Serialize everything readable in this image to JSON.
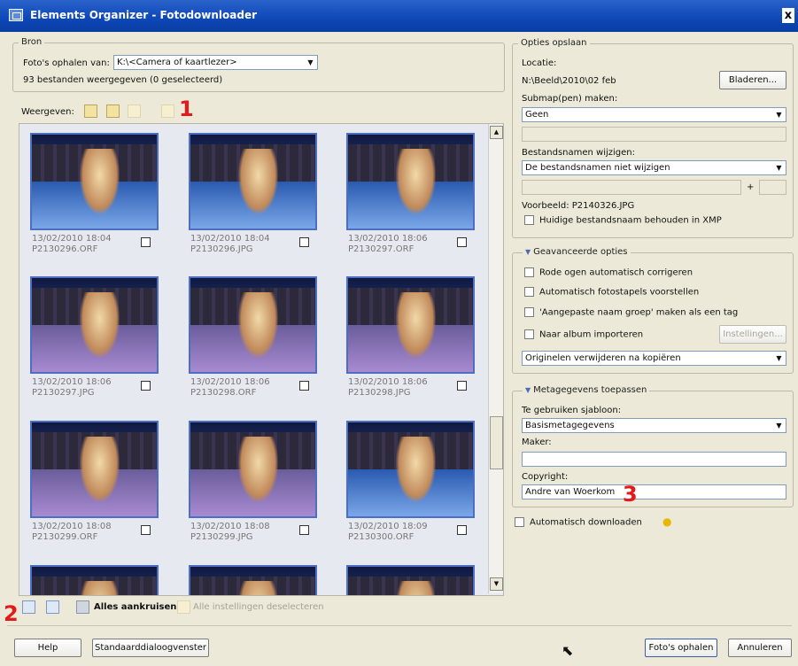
{
  "window": {
    "title": "Elements Organizer - Fotodownloader",
    "close_glyph": "x"
  },
  "source": {
    "legend": "Bron",
    "get_from_label": "Foto's ophalen van:",
    "get_from_value": "K:\\<Camera of kaartlezer>",
    "count_text": "93 bestanden weergegeven (0 geselecteerd)"
  },
  "view": {
    "label": "Weergeven:"
  },
  "thumbnails": [
    {
      "date": "13/02/2010 18:04",
      "file": "P2130296.ORF"
    },
    {
      "date": "13/02/2010 18:04",
      "file": "P2130296.JPG"
    },
    {
      "date": "13/02/2010 18:06",
      "file": "P2130297.ORF"
    },
    {
      "date": "13/02/2010 18:06",
      "file": "P2130297.JPG"
    },
    {
      "date": "13/02/2010 18:06",
      "file": "P2130298.ORF"
    },
    {
      "date": "13/02/2010 18:06",
      "file": "P2130298.JPG"
    },
    {
      "date": "13/02/2010 18:08",
      "file": "P2130299.ORF"
    },
    {
      "date": "13/02/2010 18:08",
      "file": "P2130299.JPG"
    },
    {
      "date": "13/02/2010 18:09",
      "file": "P2130300.ORF"
    },
    {
      "date": "",
      "file": ""
    },
    {
      "date": "",
      "file": ""
    },
    {
      "date": "",
      "file": ""
    }
  ],
  "bottom_toolbar": {
    "check_all": "Alles aankruisen",
    "uncheck_all": "Alle instellingen deselecteren"
  },
  "save_options": {
    "legend": "Opties opslaan",
    "location_label": "Locatie:",
    "location_value": "N:\\Beeld\\2010\\02 feb",
    "browse": "Bladeren...",
    "subfolder_label": "Submap(pen) maken:",
    "subfolder_value": "Geen",
    "rename_label": "Bestandsnamen wijzigen:",
    "rename_value": "De bestandsnamen niet wijzigen",
    "plus": "+",
    "preview": "Voorbeeld: P2140326.JPG",
    "keep_name": "Huidige bestandsnaam behouden in XMP"
  },
  "advanced": {
    "header": "Geavanceerde opties",
    "red_eye": "Rode ogen automatisch corrigeren",
    "stacks": "Automatisch fotostapels voorstellen",
    "custom_group": "'Aangepaste naam groep' maken als een tag",
    "album": "Naar album importeren",
    "settings": "Instellingen...",
    "delete_option": "Originelen verwijderen na kopiëren"
  },
  "metadata": {
    "header": "Metagegevens toepassen",
    "template_label": "Te gebruiken sjabloon:",
    "template_value": "Basismetagegevens",
    "maker_label": "Maker:",
    "maker_value": "",
    "copyright_label": "Copyright:",
    "copyright_value": "Andre van Woerkom"
  },
  "auto_download": "Automatisch downloaden",
  "footer": {
    "help": "Help",
    "standard_dialog": "Standaarddialoogvenster",
    "get_photos": "Foto's ophalen",
    "cancel": "Annuleren"
  },
  "markers": {
    "one": "1",
    "two": "2",
    "three": "3"
  },
  "colors": {
    "titlebar": "#0d47b8",
    "marker": "#e21a1a",
    "thumb_border": "#4c6fc4"
  }
}
